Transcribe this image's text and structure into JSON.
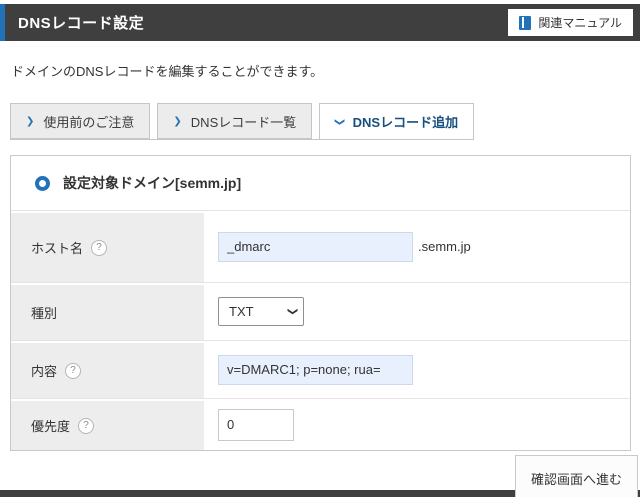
{
  "header": {
    "title": "DNSレコード設定",
    "manual_button_label": "関連マニュアル"
  },
  "description": "ドメインのDNSレコードを編集することができます。",
  "tabs": [
    {
      "label": "使用前のご注意",
      "active": false
    },
    {
      "label": "DNSレコード一覧",
      "active": false
    },
    {
      "label": "DNSレコード追加",
      "active": true
    }
  ],
  "form": {
    "section_title": "設定対象ドメイン[semm.jp]",
    "host": {
      "label": "ホスト名",
      "value": "_dmarc",
      "suffix": ".semm.jp",
      "help_glyph": "?"
    },
    "record_type": {
      "label": "種別",
      "selected": "TXT"
    },
    "content": {
      "label": "内容",
      "value": "v=DMARC1; p=none; rua=",
      "help_glyph": "?"
    },
    "priority": {
      "label": "優先度",
      "value": "0",
      "help_glyph": "?"
    }
  },
  "footer": {
    "confirm_button_label": "確認画面へ進む"
  },
  "icons": {
    "chevron_right": "❯",
    "chevron_down": "❯",
    "book": "book-icon",
    "radio_ring": "radio-ring-icon"
  },
  "colors": {
    "accent_blue": "#2272b9",
    "titlebar_bg": "#3f3f3f",
    "active_tab_text": "#17507f",
    "inactive_tab_bg": "#ececec",
    "label_cell_bg": "#ededed",
    "autofill_input_bg": "#e8f0fe"
  }
}
